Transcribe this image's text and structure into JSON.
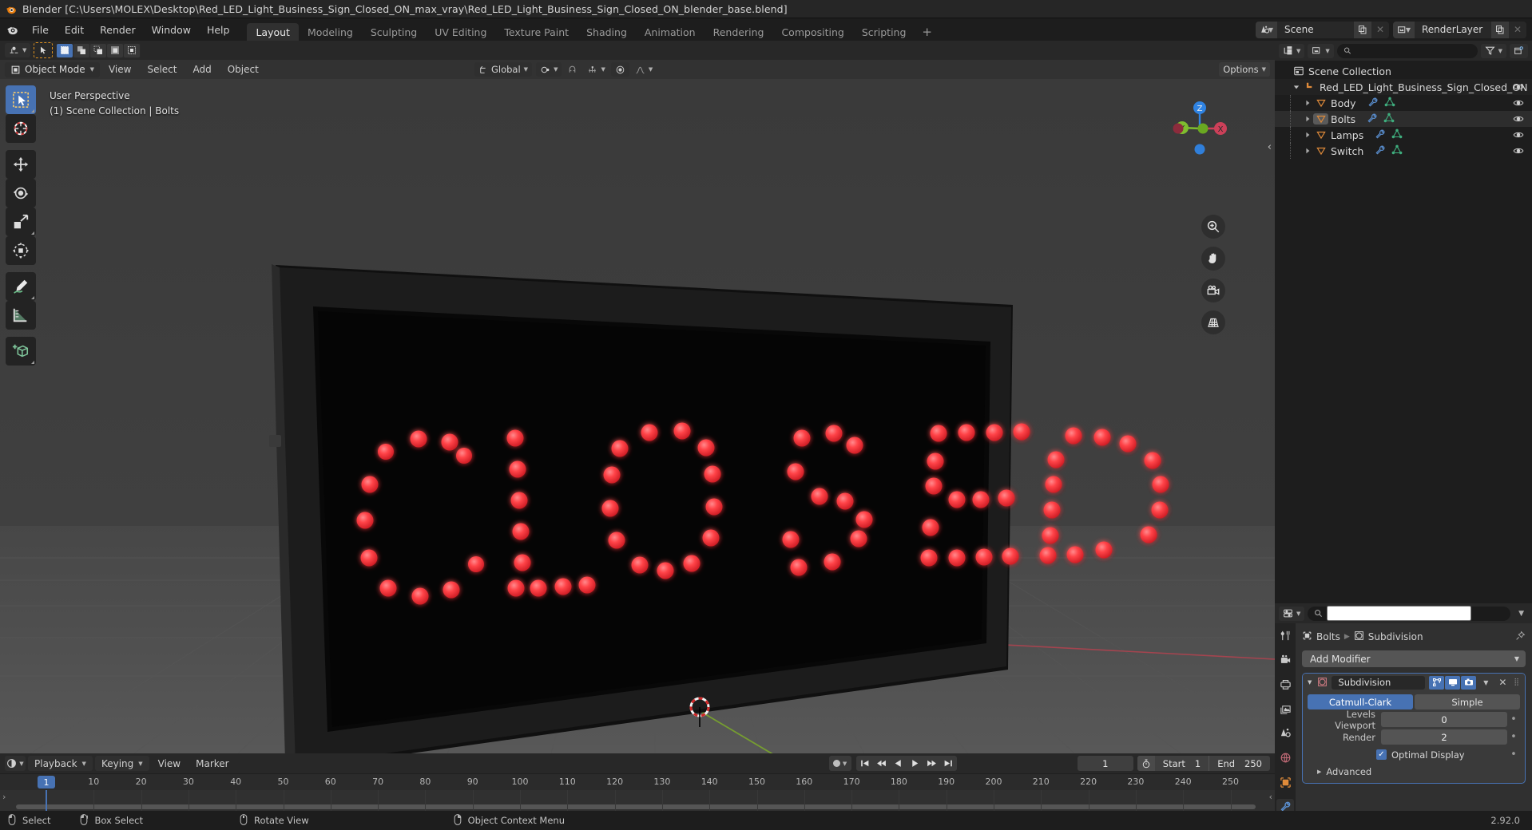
{
  "titlebar": {
    "text": "Blender [C:\\Users\\MOLEX\\Desktop\\Red_LED_Light_Business_Sign_Closed_ON_max_vray\\Red_LED_Light_Business_Sign_Closed_ON_blender_base.blend]",
    "logo_icon": "blender-logo-icon"
  },
  "topbar": {
    "menus": [
      "File",
      "Edit",
      "Render",
      "Window",
      "Help"
    ],
    "workspaces": [
      {
        "label": "Layout",
        "active": true
      },
      {
        "label": "Modeling",
        "active": false
      },
      {
        "label": "Sculpting",
        "active": false
      },
      {
        "label": "UV Editing",
        "active": false
      },
      {
        "label": "Texture Paint",
        "active": false
      },
      {
        "label": "Shading",
        "active": false
      },
      {
        "label": "Animation",
        "active": false
      },
      {
        "label": "Rendering",
        "active": false
      },
      {
        "label": "Compositing",
        "active": false
      },
      {
        "label": "Scripting",
        "active": false
      }
    ],
    "add_workspace_label": "+",
    "scene": {
      "name": "Scene",
      "icon": "scene-icon",
      "new_icon": "duplicate-icon",
      "unlink_icon": "x-icon"
    },
    "viewlayer": {
      "name": "RenderLayer",
      "icon": "viewlayer-icon",
      "new_icon": "duplicate-icon",
      "unlink_icon": "x-icon"
    }
  },
  "viewport_header": {
    "editor_type_icon": "editor-type-3dview-icon",
    "cursor_tool_icon": "select-cursor-icon",
    "select_modes": [
      "set-select-icon",
      "extend-select-icon",
      "subtract-select-icon",
      "invert-select-icon",
      "intersect-select-icon"
    ],
    "mode": "Object Mode",
    "mode_icon": "object-mode-icon",
    "menus": [
      "View",
      "Select",
      "Add",
      "Object"
    ],
    "transform_orientation": {
      "label": "Global",
      "icon": "orientation-icon"
    },
    "pivot_icon": "pivot-point-icon",
    "snap_icon": "magnet-icon",
    "snap_target_icon": "snap-increment-icon",
    "proportional_icon": "proportional-edit-icon",
    "falloff_icon": "falloff-curve-icon",
    "options_label": "Options",
    "right_controls": [
      "object-visibility-icon",
      "gizmo-icon",
      "overlays-icon",
      "xray-icon"
    ],
    "shading_modes": [
      "wireframe-shading-icon",
      "solid-shading-icon",
      "material-shading-icon",
      "rendered-shading-icon"
    ],
    "active_shading": "material-shading-icon"
  },
  "viewport": {
    "perspective_label": "User Perspective",
    "scene_info": "(1) Scene Collection | Bolts",
    "gizmo_axes": [
      {
        "label": "X",
        "color": "#cc4059"
      },
      {
        "label": "Y",
        "color": "#7fbd2f"
      },
      {
        "label": "Z",
        "color": "#2f83e3"
      }
    ],
    "nav_buttons": [
      "zoom-icon",
      "pan-hand-icon",
      "camera-view-icon",
      "toggle-perspective-icon"
    ],
    "tools": [
      {
        "name": "tweak-select-tool",
        "icon": "select-box-icon",
        "active": true
      },
      {
        "name": "cursor-tool",
        "icon": "3d-cursor-icon",
        "active": false
      },
      {
        "name": "move-tool",
        "icon": "move-arrows-icon",
        "active": false
      },
      {
        "name": "rotate-tool",
        "icon": "rotate-icon",
        "active": false
      },
      {
        "name": "scale-tool",
        "icon": "scale-icon",
        "active": false
      },
      {
        "name": "transform-tool",
        "icon": "transform-icon",
        "active": false
      },
      {
        "name": "annotate-tool",
        "icon": "pencil-icon",
        "active": false
      },
      {
        "name": "measure-tool",
        "icon": "ruler-icon",
        "active": false
      },
      {
        "name": "add-cube-tool",
        "icon": "add-cube-icon",
        "active": false
      }
    ],
    "sign_text": "CLOSED",
    "led_color": "#ff3b41",
    "sign_frame_color": "#1a1a1a",
    "floor_color": "#4a4a4a"
  },
  "outliner": {
    "display_mode_icon": "outliner-display-icon",
    "filter_icon": "filter-funnel-icon",
    "new_collection_icon": "new-collection-icon",
    "search_placeholder": "",
    "rows": [
      {
        "label": "Scene Collection",
        "icon": "collection-icon",
        "indent": 0,
        "disclosure": "",
        "eye": false,
        "extras": [],
        "selected": false
      },
      {
        "label": "Red_LED_Light_Business_Sign_Closed_ON",
        "icon": "collection-group-icon",
        "indent": 1,
        "disclosure": "down",
        "eye": true,
        "extras": [],
        "selected": false
      },
      {
        "label": "Body",
        "icon": "mesh-object-icon",
        "indent": 2,
        "disclosure": "right",
        "eye": true,
        "extras": [
          "modifier-wrench-icon",
          "mesh-data-icon"
        ],
        "selected": false
      },
      {
        "label": "Bolts",
        "icon": "mesh-object-icon",
        "indent": 2,
        "disclosure": "right",
        "eye": true,
        "extras": [
          "modifier-wrench-icon",
          "mesh-data-icon"
        ],
        "selected": true
      },
      {
        "label": "Lamps",
        "icon": "mesh-object-icon",
        "indent": 2,
        "disclosure": "right",
        "eye": true,
        "extras": [
          "modifier-wrench-icon",
          "mesh-data-icon"
        ],
        "selected": false
      },
      {
        "label": "Switch",
        "icon": "mesh-object-icon",
        "indent": 2,
        "disclosure": "right",
        "eye": true,
        "extras": [
          "modifier-wrench-icon",
          "mesh-data-icon"
        ],
        "selected": false
      }
    ]
  },
  "properties": {
    "editor_type_icon": "editor-type-properties-icon",
    "search_placeholder": "",
    "tabs": [
      {
        "name": "tool-tab",
        "icon": "tool-screwdriver-icon",
        "active": false
      },
      {
        "name": "render-tab",
        "icon": "render-camera-icon",
        "active": false
      },
      {
        "name": "output-tab",
        "icon": "output-printer-icon",
        "active": false
      },
      {
        "name": "viewlayer-tab",
        "icon": "viewlayer-images-icon",
        "active": false
      },
      {
        "name": "scene-tab",
        "icon": "scene-cone-icon",
        "active": false
      },
      {
        "name": "world-tab",
        "icon": "world-globe-icon",
        "active": false
      },
      {
        "name": "object-tab",
        "icon": "object-square-icon",
        "active": false
      },
      {
        "name": "modifier-tab",
        "icon": "modifier-wrench-icon",
        "active": true
      }
    ],
    "breadcrumb": {
      "object": "Bolts",
      "object_icon": "object-square-icon",
      "modifier": "Subdivision",
      "modifier_icon": "subdivision-circle-icon",
      "pin_icon": "pin-icon"
    },
    "add_modifier_label": "Add Modifier",
    "modifier": {
      "name": "Subdivision",
      "icon": "subdivision-circle-icon",
      "toggles": [
        {
          "name": "edit-mode-display-toggle",
          "icon": "edit-mode-icon",
          "on": true
        },
        {
          "name": "realtime-display-toggle",
          "icon": "monitor-icon",
          "on": true
        },
        {
          "name": "render-display-toggle",
          "icon": "camera-icon",
          "on": true
        }
      ],
      "dropdown_icon": "chevron-down-icon",
      "close_icon": "x-icon",
      "grip_icon": "drag-grip-icon",
      "algorithms": [
        {
          "label": "Catmull-Clark",
          "active": true
        },
        {
          "label": "Simple",
          "active": false
        }
      ],
      "fields": [
        {
          "label": "Levels Viewport",
          "value": "0"
        },
        {
          "label": "Render",
          "value": "2"
        }
      ],
      "optimal_display": {
        "label": "Optimal Display",
        "checked": true
      },
      "advanced_label": "Advanced"
    }
  },
  "timeline": {
    "editor_type_icon": "editor-type-timeline-icon",
    "menus": [
      "Playback",
      "Keying",
      "View",
      "Marker"
    ],
    "auto_key_icon": "record-dot-icon",
    "transport": [
      "jump-start-icon",
      "prev-keyframe-icon",
      "play-reverse-icon",
      "play-icon",
      "next-keyframe-icon",
      "jump-end-icon"
    ],
    "current_frame": "1",
    "timer_icon": "stopwatch-icon",
    "start_label": "Start",
    "start_value": "1",
    "end_label": "End",
    "end_value": "250",
    "ticks": [
      "10",
      "20",
      "30",
      "40",
      "50",
      "60",
      "70",
      "80",
      "90",
      "100",
      "110",
      "120",
      "130",
      "140",
      "150",
      "160",
      "170",
      "180",
      "190",
      "200",
      "210",
      "220",
      "230",
      "240",
      "250"
    ],
    "playhead_frame": "1"
  },
  "statusbar": {
    "items": [
      {
        "label": "Select",
        "icon": "mouse-left-icon"
      },
      {
        "label": "Box Select",
        "icon": "mouse-left-drag-icon"
      },
      {
        "label": "Rotate View",
        "icon": "mouse-middle-icon"
      },
      {
        "label": "Object Context Menu",
        "icon": "mouse-right-icon"
      }
    ],
    "version": "2.92.0"
  }
}
